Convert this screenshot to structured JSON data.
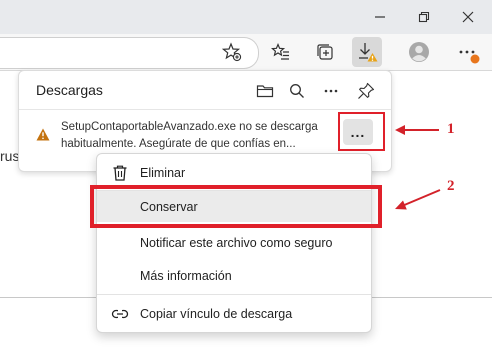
{
  "window": {
    "minimize_icon": "minimize-icon",
    "restore_icon": "restore-icon",
    "close_icon": "close-icon"
  },
  "toolbar": {
    "icons": [
      "favorite-add-icon",
      "favorites-icon",
      "collections-icon",
      "downloads-warning-icon",
      "profile-icon",
      "more-icon"
    ]
  },
  "page": {
    "partial_text": "rus"
  },
  "downloads_panel": {
    "title": "Descargas",
    "header_icons": [
      "folder-icon",
      "search-icon",
      "more-icon",
      "pin-icon"
    ],
    "item": {
      "line1": "SetupContaportableAvanzado.exe no se descarga",
      "line2": "habitualmente. Asegúrate de que confías en...",
      "more_label": "..."
    }
  },
  "context_menu": {
    "items": [
      {
        "label": "Eliminar",
        "icon": "trash-icon"
      },
      {
        "label": "Conservar",
        "icon": ""
      },
      {
        "label": "Notificar este archivo como seguro",
        "icon": ""
      },
      {
        "label": "Más información",
        "icon": ""
      },
      {
        "label": "Copiar vínculo de descarga",
        "icon": "link-icon"
      }
    ]
  },
  "annotations": {
    "label_1": "1",
    "label_2": "2",
    "color": "#e0202a"
  }
}
